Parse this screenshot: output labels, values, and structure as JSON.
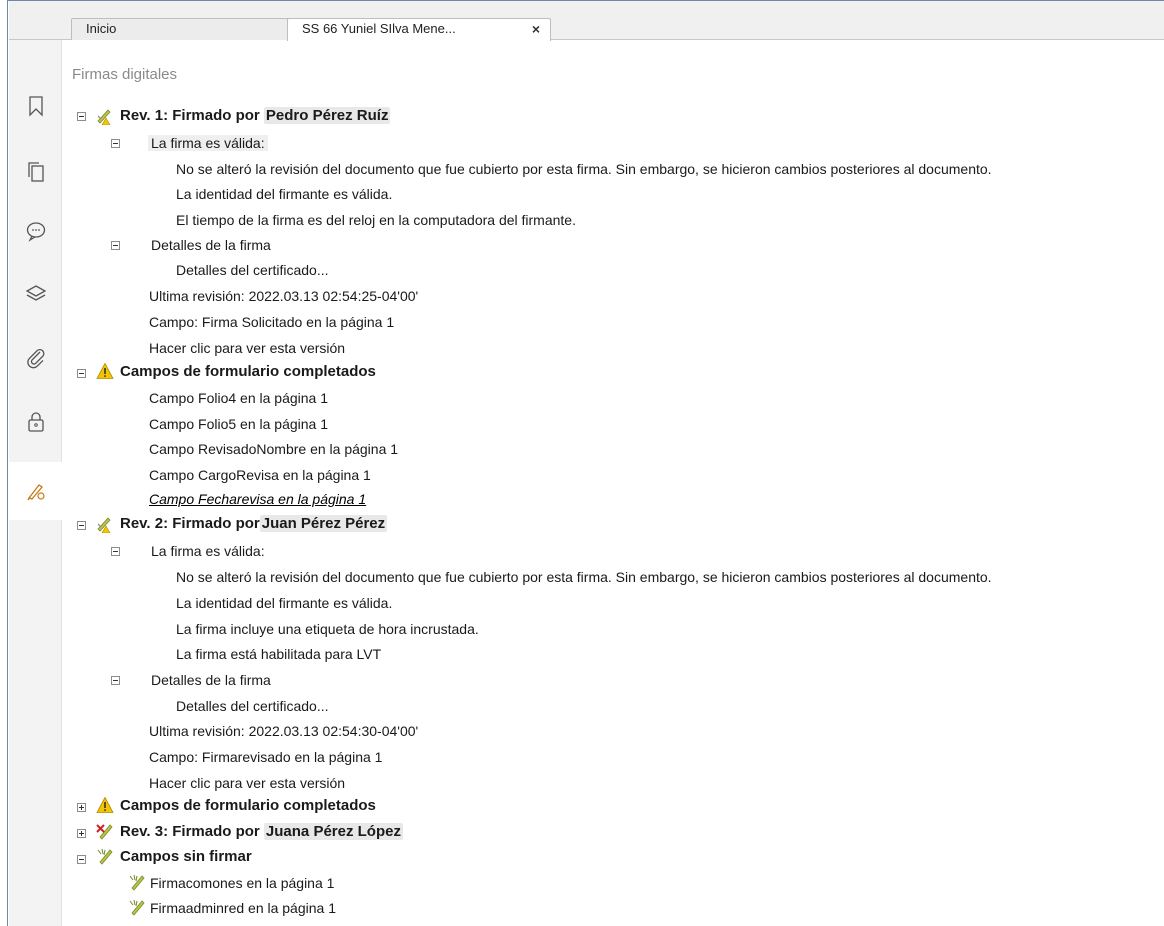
{
  "tabs": [
    {
      "label": "Inicio"
    },
    {
      "label": "SS 66 Yuniel SIlva Mene...",
      "close": "×"
    }
  ],
  "rail": [
    "bookmark-icon",
    "pages-icon",
    "comment-icon",
    "layers-icon",
    "attachment-icon",
    "lock-icon",
    "signature-icon"
  ],
  "panel": {
    "title": "Firmas digitales",
    "rev1": {
      "title": "Rev. 1: Firmado por ",
      "signer": "Pedro Pérez Ruíz",
      "valid": "La firma es válida:",
      "msg1": "No se alteró la revisión del documento que fue cubierto por esta firma. Sin embargo, se hicieron cambios posteriores al documento.",
      "msg2": "La identidad del firmante es válida.",
      "msg3": "El tiempo de la firma es del reloj en la computadora del firmante.",
      "details": "Detalles de la firma",
      "cert": "Detalles del certificado...",
      "last": "Ultima revisión: 2022.03.13 02:54:25-04'00'",
      "field": "Campo: Firma Solicitado en la página 1",
      "click": "Hacer clic para ver esta versión"
    },
    "forms1": {
      "title": "Campos de formulario completados",
      "items": [
        "Campo Folio4 en la página 1",
        "Campo Folio5 en la página 1",
        "Campo RevisadoNombre en la página 1",
        "Campo CargoRevisa en la página 1",
        "Campo Fecharevisa en la página 1"
      ]
    },
    "rev2": {
      "title": "Rev. 2: Firmado por",
      "signer": "Juan Pérez Pérez",
      "valid": "La firma es válida:",
      "msg1": "No se alteró la revisión del documento que fue cubierto por esta firma. Sin embargo, se hicieron cambios posteriores al documento.",
      "msg2": "La identidad del firmante es válida.",
      "msg3": "La firma incluye una etiqueta de hora incrustada.",
      "msg4": "La firma está habilitada para LVT",
      "details": "Detalles de la firma",
      "cert": "Detalles del certificado...",
      "last": "Ultima revisión: 2022.03.13 02:54:30-04'00'",
      "field": "Campo: Firmarevisado en la página 1",
      "click": "Hacer clic para ver esta versión"
    },
    "forms2": {
      "title": "Campos de formulario completados"
    },
    "rev3": {
      "title": "Rev. 3: Firmado por ",
      "signer": "Juana Pérez López"
    },
    "unsigned": {
      "title": "Campos sin firmar",
      "items": [
        "Firmacomones en la página 1",
        "Firmaadminred en la página 1"
      ]
    }
  },
  "colors": {
    "warning": "#f5c400",
    "valid_pen": "#9aaa3a",
    "invalid_x": "#d0202a",
    "frame": "#6f88a8"
  }
}
